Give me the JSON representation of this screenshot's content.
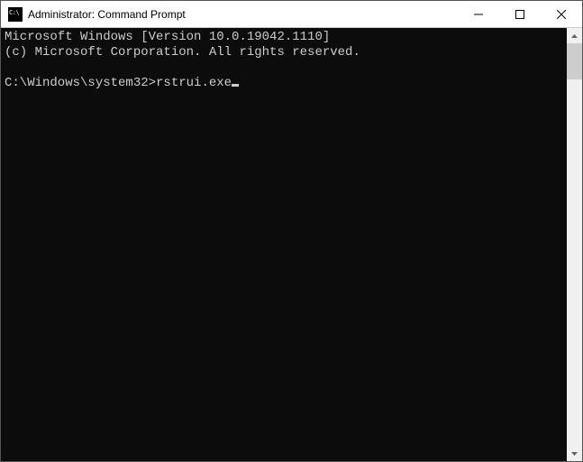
{
  "titlebar": {
    "title": "Administrator: Command Prompt",
    "icon": "cmd-icon",
    "buttons": {
      "minimize": "minimize",
      "maximize": "maximize",
      "close": "close"
    }
  },
  "terminal": {
    "line1": "Microsoft Windows [Version 10.0.19042.1110]",
    "line2": "(c) Microsoft Corporation. All rights reserved.",
    "blank": "",
    "prompt": "C:\\Windows\\system32>",
    "command": "rstrui.exe"
  }
}
